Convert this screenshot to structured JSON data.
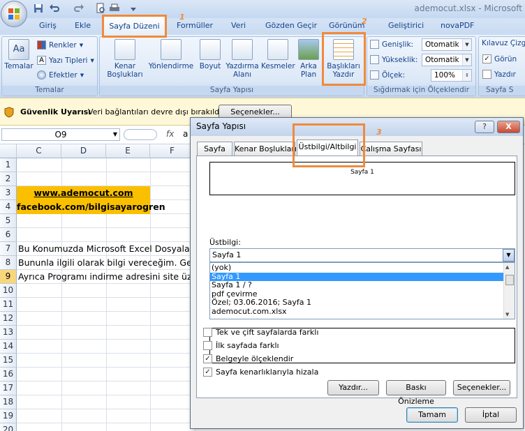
{
  "window": {
    "title": "ademocut.xlsx - Microsoft"
  },
  "tabs": [
    "Giriş",
    "Ekle",
    "Sayfa Düzeni",
    "Formüller",
    "Veri",
    "Gözden Geçir",
    "Görünüm",
    "Geliştirici",
    "novaPDF"
  ],
  "annotations": [
    "1",
    "2",
    "3"
  ],
  "ribbon": {
    "temalar": {
      "big": "Temalar",
      "renkler": "Renkler",
      "yazi": "Yazı Tipleri",
      "efektler": "Efektler",
      "group": "Temalar"
    },
    "sayfa_yapisi": {
      "buttons": [
        "Kenar\nBoşlukları",
        "Yönlendirme",
        "Boyut",
        "Yazdırma\nAlanı",
        "Kesmeler",
        "Arka\nPlan",
        "Başlıkları\nYazdır"
      ],
      "group": "Sayfa Yapısı"
    },
    "scale": {
      "genislik_label": "Genişlik:",
      "genislik_value": "Otomatik",
      "yukseklik_label": "Yükseklik:",
      "yukseklik_value": "Otomatik",
      "olcek_label": "Ölçek:",
      "olcek_value": "100%",
      "group": "Sığdırmak için Ölçeklendir"
    },
    "kilavuz": {
      "title": "Kılavuz Çizgi",
      "gorunum": "Görün",
      "yazdir": "Yazdır",
      "group": "Sayfa S"
    }
  },
  "security": {
    "title": "Güvenlik Uyarısı",
    "message": "Veri bağlantıları devre dışı bırakıldı",
    "button": "Seçenekler..."
  },
  "formula": {
    "namebox": "O9",
    "fx": "fx",
    "content": "a"
  },
  "sheet": {
    "columns": [
      "C",
      "D",
      "E",
      "F"
    ],
    "rows": [
      "1",
      "2",
      "3",
      "4",
      "5",
      "6",
      "7",
      "8",
      "9",
      "10",
      "11",
      "12",
      "13",
      "14",
      "15",
      "16",
      "17",
      "18",
      "19",
      "20"
    ],
    "cells": {
      "r3": "www.ademocut.com",
      "r4": "facebook.com/bilgisayarogren",
      "r7": "Bu Konumuzda Microsoft Excel Dosyalar",
      "r8": "Bununla ilgili olarak bilgi vereceğim. Ger",
      "r9": "Ayrıca Programı indirme adresini site üze"
    }
  },
  "dialog": {
    "title": "Sayfa Yapısı",
    "help": "?",
    "close": "X",
    "tabs": [
      "Sayfa",
      "Kenar Boşlukları",
      "Üstbilgi/Altbilgi",
      "Çalışma Sayfası"
    ],
    "preview_text": "Sayfa 1",
    "ustbilgi_label": "Üstbilgi:",
    "ustbilgi_value": "Sayfa 1",
    "options": [
      "(yok)",
      "Sayfa 1",
      "Sayfa 1 / ?",
      "pdf çevirme",
      " Özel; 03.06.2016; Sayfa 1",
      "ademocut.com.xlsx"
    ],
    "selected_option": "Sayfa 1",
    "checks": [
      {
        "label": "Tek ve çift sayfalarda farklı",
        "checked": false
      },
      {
        "label": "İlk sayfada farklı",
        "checked": false
      },
      {
        "label": "Belgeyle ölçeklendir",
        "checked": true
      },
      {
        "label": "Sayfa kenarlıklarıyla hizala",
        "checked": true
      }
    ],
    "buttons": {
      "yazdir": "Yazdır...",
      "baski": "Baskı Önizleme",
      "secenekler": "Seçenekler...",
      "tamam": "Tamam",
      "iptal": "İptal"
    }
  },
  "colors": {
    "accent_highlight": "#f08a3c",
    "cell_fill": "#fac000",
    "selection": "#3399ff"
  }
}
